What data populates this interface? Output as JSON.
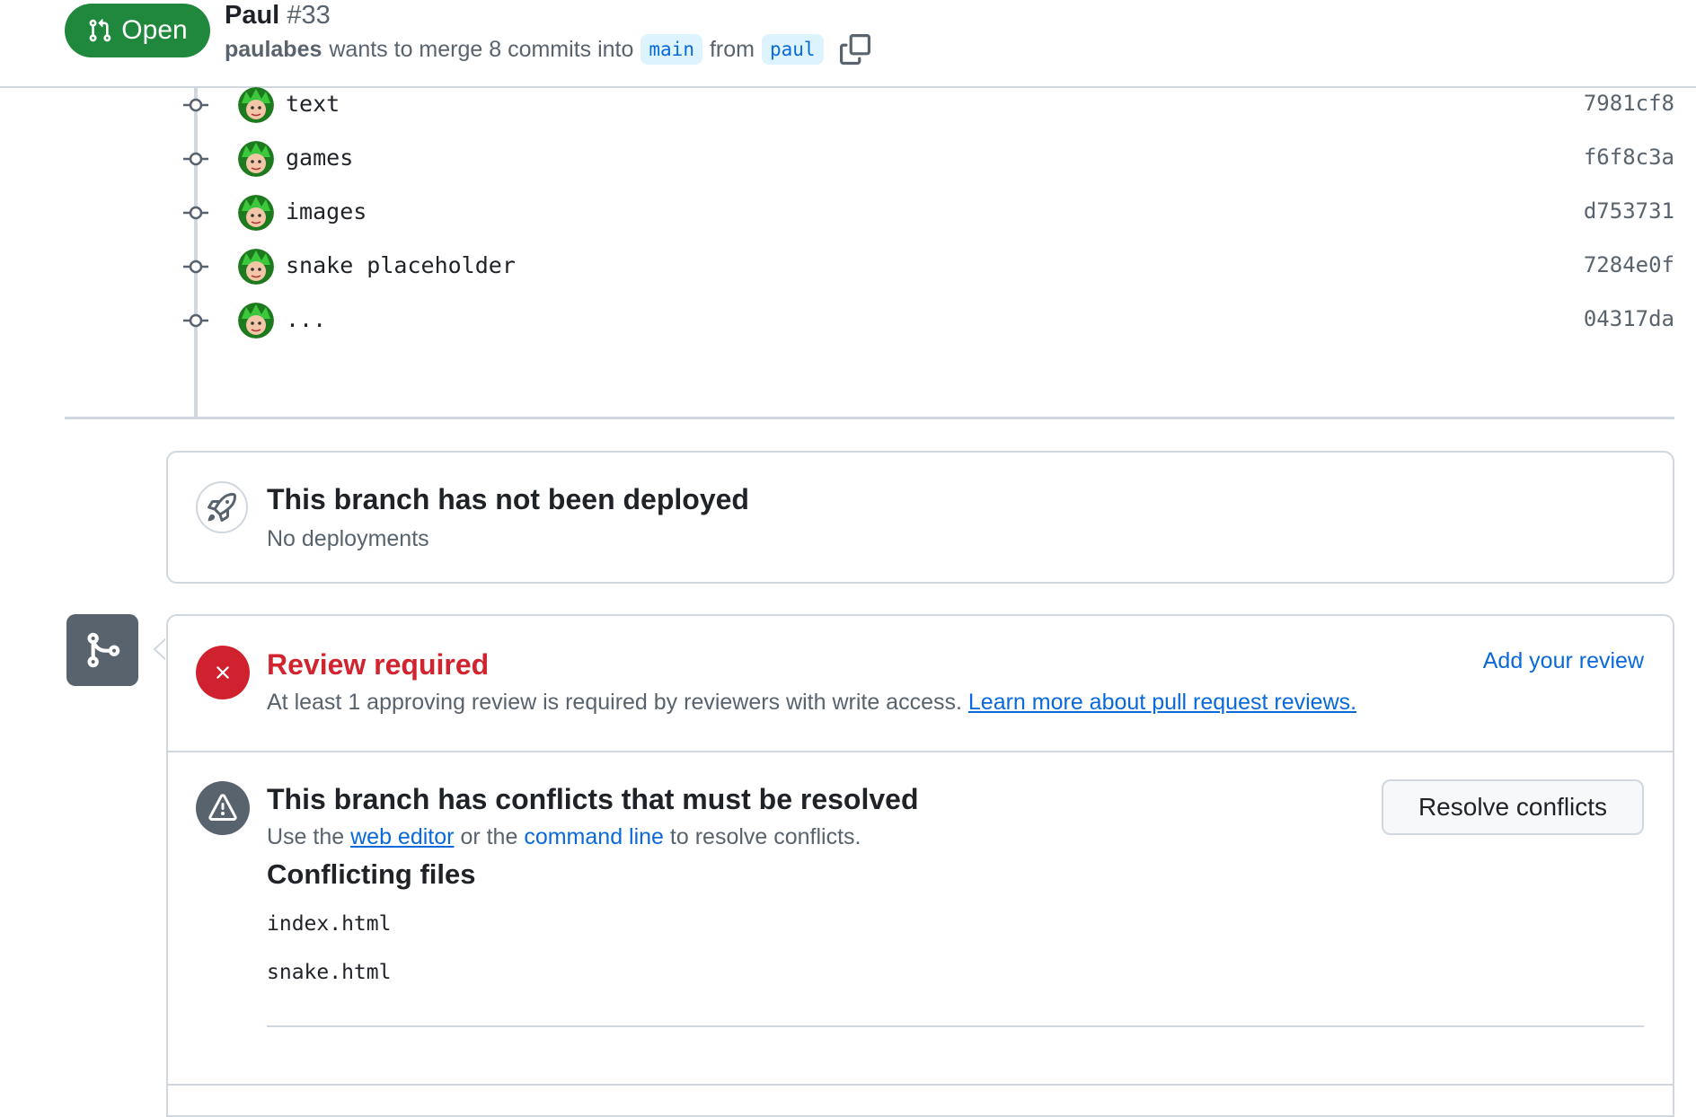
{
  "header": {
    "state": "Open",
    "title": "Paul",
    "number": "#33",
    "author": "paulabes",
    "merge_text_1": "wants to merge 8 commits into",
    "base_branch": "main",
    "merge_text_2": "from",
    "head_branch": "paul"
  },
  "commits": [
    {
      "message": "text",
      "sha": "7981cf8"
    },
    {
      "message": "games",
      "sha": "f6f8c3a"
    },
    {
      "message": "images",
      "sha": "d753731"
    },
    {
      "message": "snake placeholder",
      "sha": "7284e0f"
    },
    {
      "message": "...",
      "sha": "04317da"
    }
  ],
  "deployment": {
    "title": "This branch has not been deployed",
    "subtitle": "No deployments"
  },
  "review": {
    "title": "Review required",
    "description": "At least 1 approving review is required by reviewers with write access.",
    "learn_more": "Learn more about pull request reviews.",
    "add_review": "Add your review"
  },
  "conflicts": {
    "title": "This branch has conflicts that must be resolved",
    "desc_1": "Use the",
    "web_editor": "web editor",
    "desc_2": "or the",
    "command_line": "command line",
    "desc_3": "to resolve conflicts.",
    "files_heading": "Conflicting files",
    "files": [
      "index.html",
      "snake.html"
    ],
    "resolve_button": "Resolve conflicts"
  },
  "colors": {
    "open": "#1f883d",
    "danger": "#cf222e",
    "link": "#0969da",
    "muted": "#59636e",
    "border": "#d0d7de"
  }
}
